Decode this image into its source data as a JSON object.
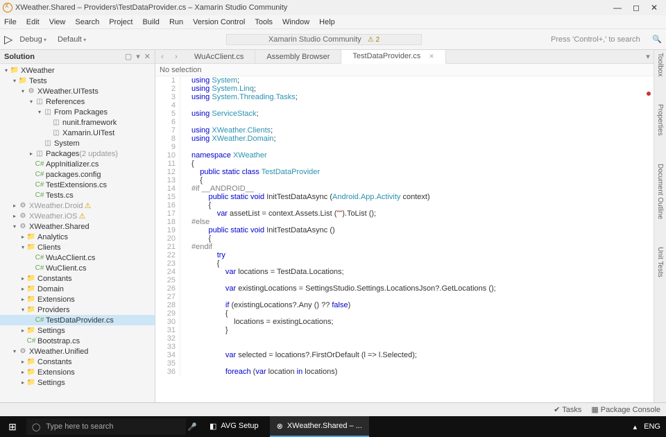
{
  "window": {
    "title": "XWeather.Shared – Providers\\TestDataProvider.cs – Xamarin Studio Community"
  },
  "winctrls": {
    "min": "—",
    "max": "◻",
    "close": "✕"
  },
  "menu": [
    "File",
    "Edit",
    "View",
    "Search",
    "Project",
    "Build",
    "Run",
    "Version Control",
    "Tools",
    "Window",
    "Help"
  ],
  "toolbar": {
    "debug": "Debug",
    "default": "Default",
    "status": "Xamarin Studio Community",
    "warncount": "⚠ 2",
    "search": "Press 'Control+,' to search"
  },
  "sidebar": {
    "title": "Solution",
    "tools": [
      "▢",
      "▾",
      "✕"
    ]
  },
  "tree": [
    {
      "d": 0,
      "tw": "▾",
      "ic": "fld",
      "lbl": "XWeather"
    },
    {
      "d": 1,
      "tw": "▾",
      "ic": "fldb",
      "lbl": "Tests"
    },
    {
      "d": 2,
      "tw": "▾",
      "ic": "gear",
      "lbl": "XWeather.UITests"
    },
    {
      "d": 3,
      "tw": "▾",
      "ic": "ref",
      "lbl": "References"
    },
    {
      "d": 4,
      "tw": "▾",
      "ic": "ref",
      "lbl": "From Packages"
    },
    {
      "d": 5,
      "tw": "",
      "ic": "ref",
      "lbl": "nunit.framework"
    },
    {
      "d": 5,
      "tw": "",
      "ic": "ref",
      "lbl": "Xamarin.UITest"
    },
    {
      "d": 4,
      "tw": "",
      "ic": "ref",
      "lbl": "System"
    },
    {
      "d": 3,
      "tw": "▸",
      "ic": "ref",
      "lbl": "Packages",
      "muted": " (2 updates)"
    },
    {
      "d": 3,
      "tw": "",
      "ic": "cs",
      "lbl": "AppInitializer.cs"
    },
    {
      "d": 3,
      "tw": "",
      "ic": "cs",
      "lbl": "packages.config"
    },
    {
      "d": 3,
      "tw": "",
      "ic": "cs",
      "lbl": "TestExtensions.cs"
    },
    {
      "d": 3,
      "tw": "",
      "ic": "cs",
      "lbl": "Tests.cs"
    },
    {
      "d": 1,
      "tw": "▸",
      "ic": "gear",
      "lbl": "XWeather.Droid",
      "warn": true,
      "dis": true
    },
    {
      "d": 1,
      "tw": "▸",
      "ic": "gear",
      "lbl": "XWeather.iOS",
      "warn": true,
      "dis": true
    },
    {
      "d": 1,
      "tw": "▾",
      "ic": "gear",
      "lbl": "XWeather.Shared"
    },
    {
      "d": 2,
      "tw": "▸",
      "ic": "fldb",
      "lbl": "Analytics"
    },
    {
      "d": 2,
      "tw": "▾",
      "ic": "fldb",
      "lbl": "Clients"
    },
    {
      "d": 3,
      "tw": "",
      "ic": "cs",
      "lbl": "WuAcClient.cs"
    },
    {
      "d": 3,
      "tw": "",
      "ic": "cs",
      "lbl": "WuClient.cs"
    },
    {
      "d": 2,
      "tw": "▸",
      "ic": "fldb",
      "lbl": "Constants"
    },
    {
      "d": 2,
      "tw": "▸",
      "ic": "fldb",
      "lbl": "Domain"
    },
    {
      "d": 2,
      "tw": "▸",
      "ic": "fldb",
      "lbl": "Extensions"
    },
    {
      "d": 2,
      "tw": "▾",
      "ic": "fldb",
      "lbl": "Providers"
    },
    {
      "d": 3,
      "tw": "",
      "ic": "cs",
      "lbl": "TestDataProvider.cs",
      "sel": true
    },
    {
      "d": 2,
      "tw": "▸",
      "ic": "fldb",
      "lbl": "Settings"
    },
    {
      "d": 2,
      "tw": "",
      "ic": "cs",
      "lbl": "Bootstrap.cs"
    },
    {
      "d": 1,
      "tw": "▾",
      "ic": "gear",
      "lbl": "XWeather.Unified"
    },
    {
      "d": 2,
      "tw": "▸",
      "ic": "fldb",
      "lbl": "Constants"
    },
    {
      "d": 2,
      "tw": "▸",
      "ic": "fldb",
      "lbl": "Extensions"
    },
    {
      "d": 2,
      "tw": "▸",
      "ic": "fldb",
      "lbl": "Settings"
    }
  ],
  "tabs": [
    {
      "label": "WuAcClient.cs"
    },
    {
      "label": "Assembly Browser"
    },
    {
      "label": "TestDataProvider.cs",
      "active": true
    }
  ],
  "crumb": "No selection",
  "code": [
    {
      "n": 1,
      "t": "<kw>using</kw> <cls>System</cls>;"
    },
    {
      "n": 2,
      "t": "<kw>using</kw> <cls>System.Linq</cls>;"
    },
    {
      "n": 3,
      "t": "<kw>using</kw> <cls>System.Threading.Tasks</cls>;"
    },
    {
      "n": 4,
      "t": ""
    },
    {
      "n": 5,
      "t": "<kw>using</kw> <cls>ServiceStack</cls>;"
    },
    {
      "n": 6,
      "t": ""
    },
    {
      "n": 7,
      "t": "<kw>using</kw> <cls>XWeather.Clients</cls>;"
    },
    {
      "n": 8,
      "t": "<kw>using</kw> <cls>XWeather.Domain</cls>;"
    },
    {
      "n": 9,
      "t": ""
    },
    {
      "n": 10,
      "t": "<kw>namespace</kw> <cls>XWeather</cls>"
    },
    {
      "n": 11,
      "t": "{"
    },
    {
      "n": 12,
      "t": "    <kw>public static class</kw> <cls>TestDataProvider</cls>"
    },
    {
      "n": 13,
      "t": "    {"
    },
    {
      "n": 14,
      "t": "<pp>#if __ANDROID__</pp>"
    },
    {
      "n": 15,
      "t": "        <kw>public static void</kw> InitTestDataAsync (<cls>Android.App.Activity</cls> context)"
    },
    {
      "n": 16,
      "t": "        {"
    },
    {
      "n": 17,
      "t": "            <kw>var</kw> assetList = context.Assets.List (<str>\"\"</str>).ToList ();"
    },
    {
      "n": 18,
      "t": "<pp>#else</pp>"
    },
    {
      "n": 19,
      "t": "        <kw>public static void</kw> InitTestDataAsync ()"
    },
    {
      "n": 20,
      "t": "        {"
    },
    {
      "n": 21,
      "t": "<pp>#endif</pp>"
    },
    {
      "n": 22,
      "t": "            <kw>try</kw>"
    },
    {
      "n": 23,
      "t": "            {"
    },
    {
      "n": 24,
      "t": "                <kw>var</kw> locations = TestData.Locations;"
    },
    {
      "n": 25,
      "t": ""
    },
    {
      "n": 26,
      "t": "                <kw>var</kw> existingLocations = SettingsStudio.Settings.LocationsJson?.GetLocations ();"
    },
    {
      "n": 27,
      "t": ""
    },
    {
      "n": 28,
      "t": "                <kw>if</kw> (existingLocations?.Any () ?? <kw>false</kw>)"
    },
    {
      "n": 29,
      "t": "                {"
    },
    {
      "n": 30,
      "t": "                    locations = existingLocations;"
    },
    {
      "n": 31,
      "t": "                }"
    },
    {
      "n": 32,
      "t": ""
    },
    {
      "n": 33,
      "t": ""
    },
    {
      "n": 34,
      "t": "                <kw>var</kw> selected = locations?.FirstOrDefault (l => l.Selected);"
    },
    {
      "n": 35,
      "t": ""
    },
    {
      "n": 36,
      "t": "                <kw>foreach</kw> (<kw>var</kw> location <kw>in</kw> locations)"
    }
  ],
  "statusbar": {
    "tasks": "✔ Tasks",
    "pkg": "▦ Package Console"
  },
  "rside": [
    "Toolbox",
    "Properties",
    "Document Outline",
    "Unit Tests"
  ],
  "taskbar": {
    "search": "Type here to search",
    "tasks": [
      {
        "label": "AVG Setup",
        "ic": "◧"
      },
      {
        "label": "XWeather.Shared – ...",
        "ic": "⊗",
        "active": true
      }
    ],
    "sys": {
      "up": "▴",
      "lang": "ENG"
    }
  }
}
